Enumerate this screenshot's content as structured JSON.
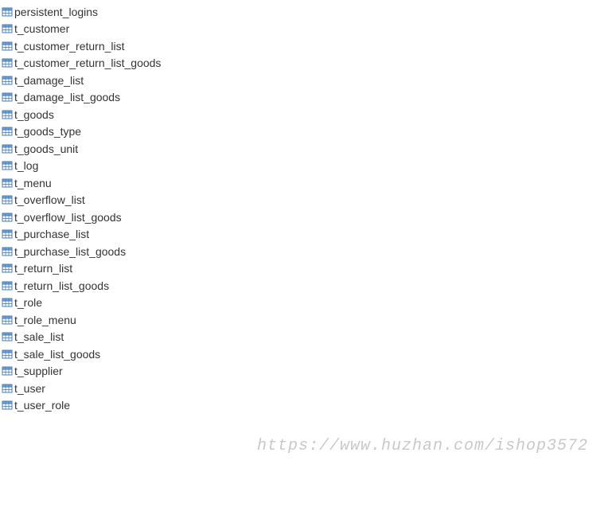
{
  "tables": [
    {
      "name": "persistent_logins"
    },
    {
      "name": "t_customer"
    },
    {
      "name": "t_customer_return_list"
    },
    {
      "name": "t_customer_return_list_goods"
    },
    {
      "name": "t_damage_list"
    },
    {
      "name": "t_damage_list_goods"
    },
    {
      "name": "t_goods"
    },
    {
      "name": "t_goods_type"
    },
    {
      "name": "t_goods_unit"
    },
    {
      "name": "t_log"
    },
    {
      "name": "t_menu"
    },
    {
      "name": "t_overflow_list"
    },
    {
      "name": "t_overflow_list_goods"
    },
    {
      "name": "t_purchase_list"
    },
    {
      "name": "t_purchase_list_goods"
    },
    {
      "name": "t_return_list"
    },
    {
      "name": "t_return_list_goods"
    },
    {
      "name": "t_role"
    },
    {
      "name": "t_role_menu"
    },
    {
      "name": "t_sale_list"
    },
    {
      "name": "t_sale_list_goods"
    },
    {
      "name": "t_supplier"
    },
    {
      "name": "t_user"
    },
    {
      "name": "t_user_role"
    }
  ],
  "watermark": "https://www.huzhan.com/ishop3572",
  "icon_colors": {
    "header": "#6fa8dc",
    "body": "#ffffff",
    "border": "#4a7bb5"
  }
}
